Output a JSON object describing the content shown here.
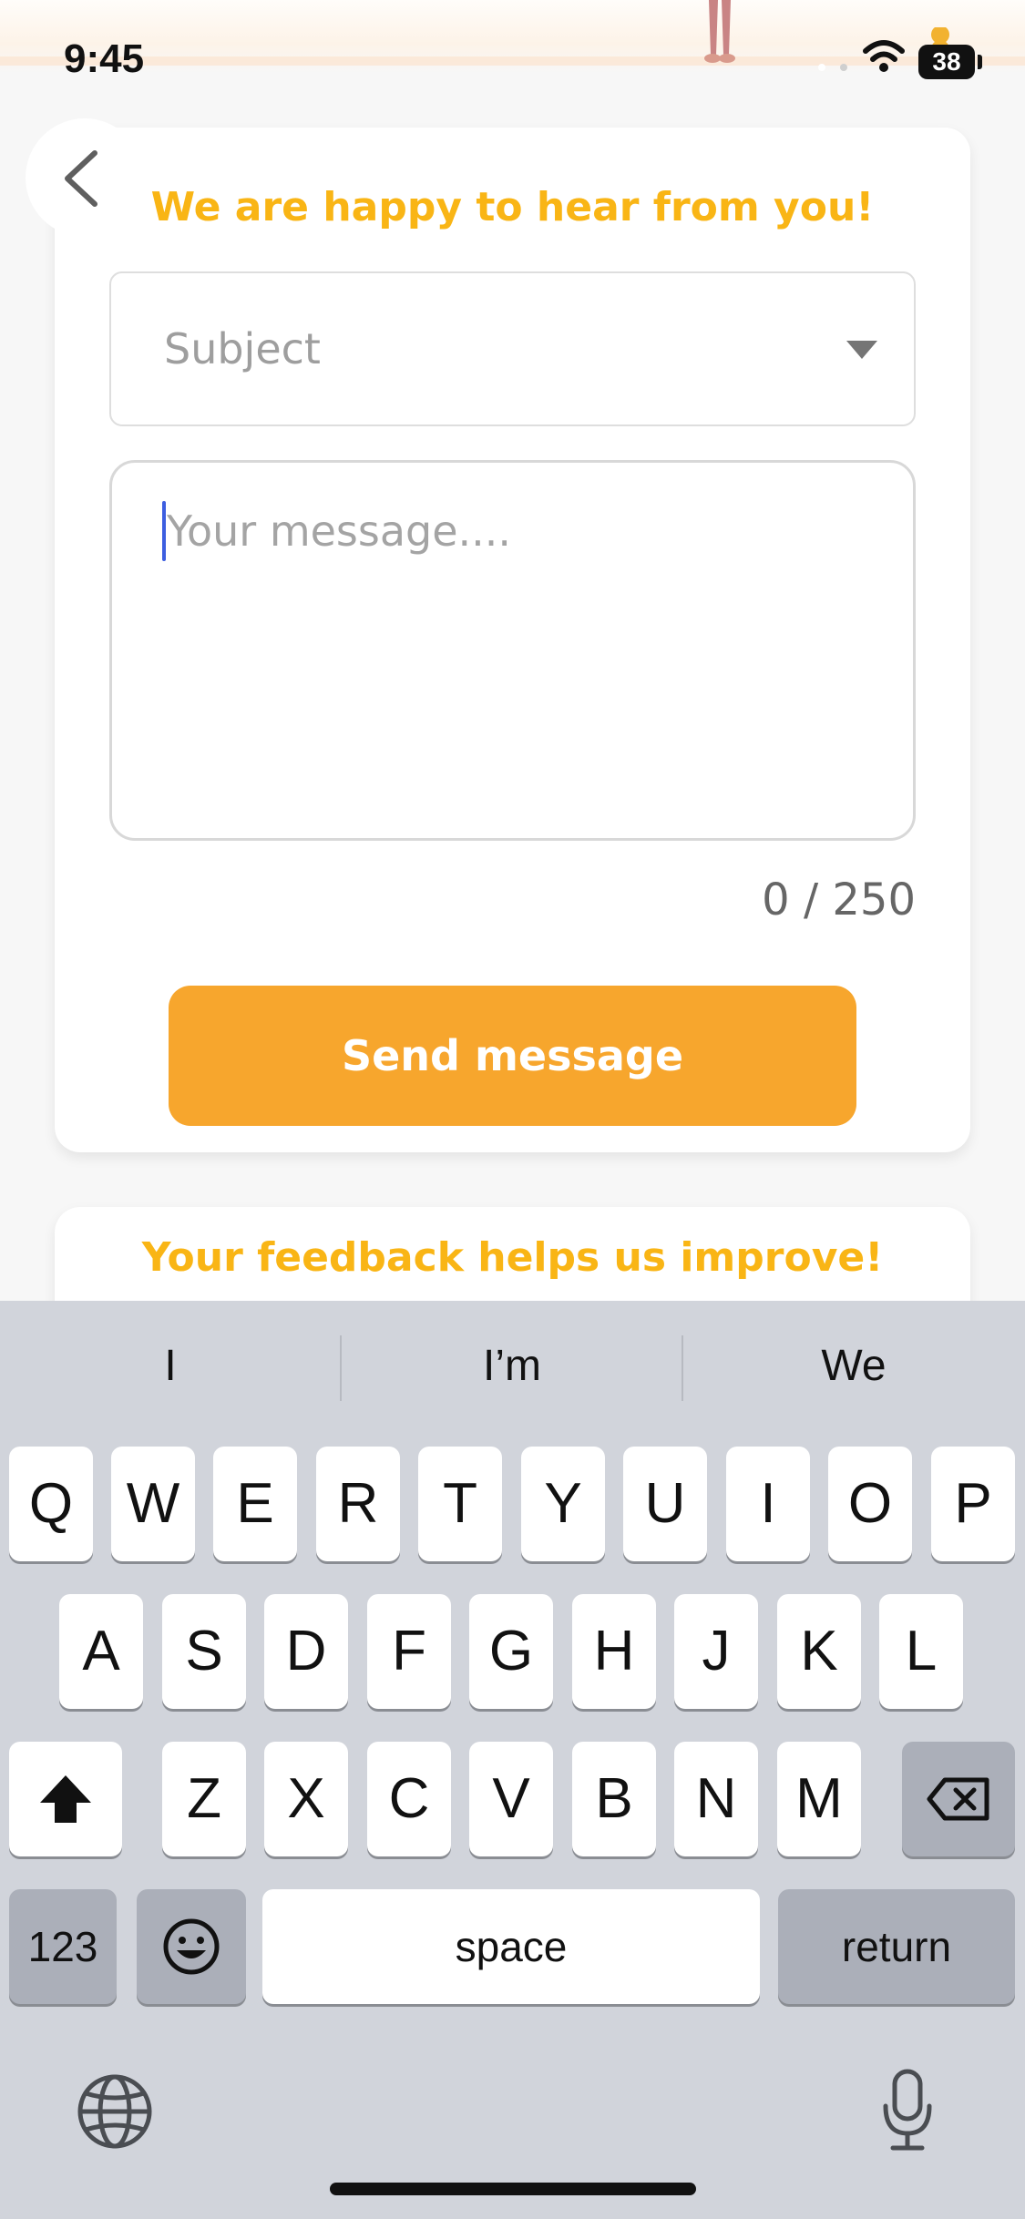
{
  "status_bar": {
    "time": "9:45",
    "battery": "38"
  },
  "form": {
    "title": "We are happy to hear from you!",
    "subject_placeholder": "Subject",
    "message_placeholder": "Your message....",
    "char_counter": "0 / 250",
    "send_label": "Send message"
  },
  "feedback": {
    "title": "Your feedback helps us improve!"
  },
  "keyboard": {
    "suggestions": [
      "I",
      "I’m",
      "We"
    ],
    "row1": [
      "Q",
      "W",
      "E",
      "R",
      "T",
      "Y",
      "U",
      "I",
      "O",
      "P"
    ],
    "row2": [
      "A",
      "S",
      "D",
      "F",
      "G",
      "H",
      "J",
      "K",
      "L"
    ],
    "row3": [
      "Z",
      "X",
      "C",
      "V",
      "B",
      "N",
      "M"
    ],
    "numbers_label": "123",
    "space_label": "space",
    "return_label": "return"
  },
  "colors": {
    "accent_yellow": "#f9b515",
    "button_orange": "#f7a62d",
    "caret_blue": "#3d5ee0"
  },
  "icons": [
    "back-chevron-icon",
    "dropdown-arrow-icon",
    "wifi-icon",
    "shift-icon",
    "backspace-icon",
    "emoji-icon",
    "globe-icon",
    "microphone-icon"
  ]
}
